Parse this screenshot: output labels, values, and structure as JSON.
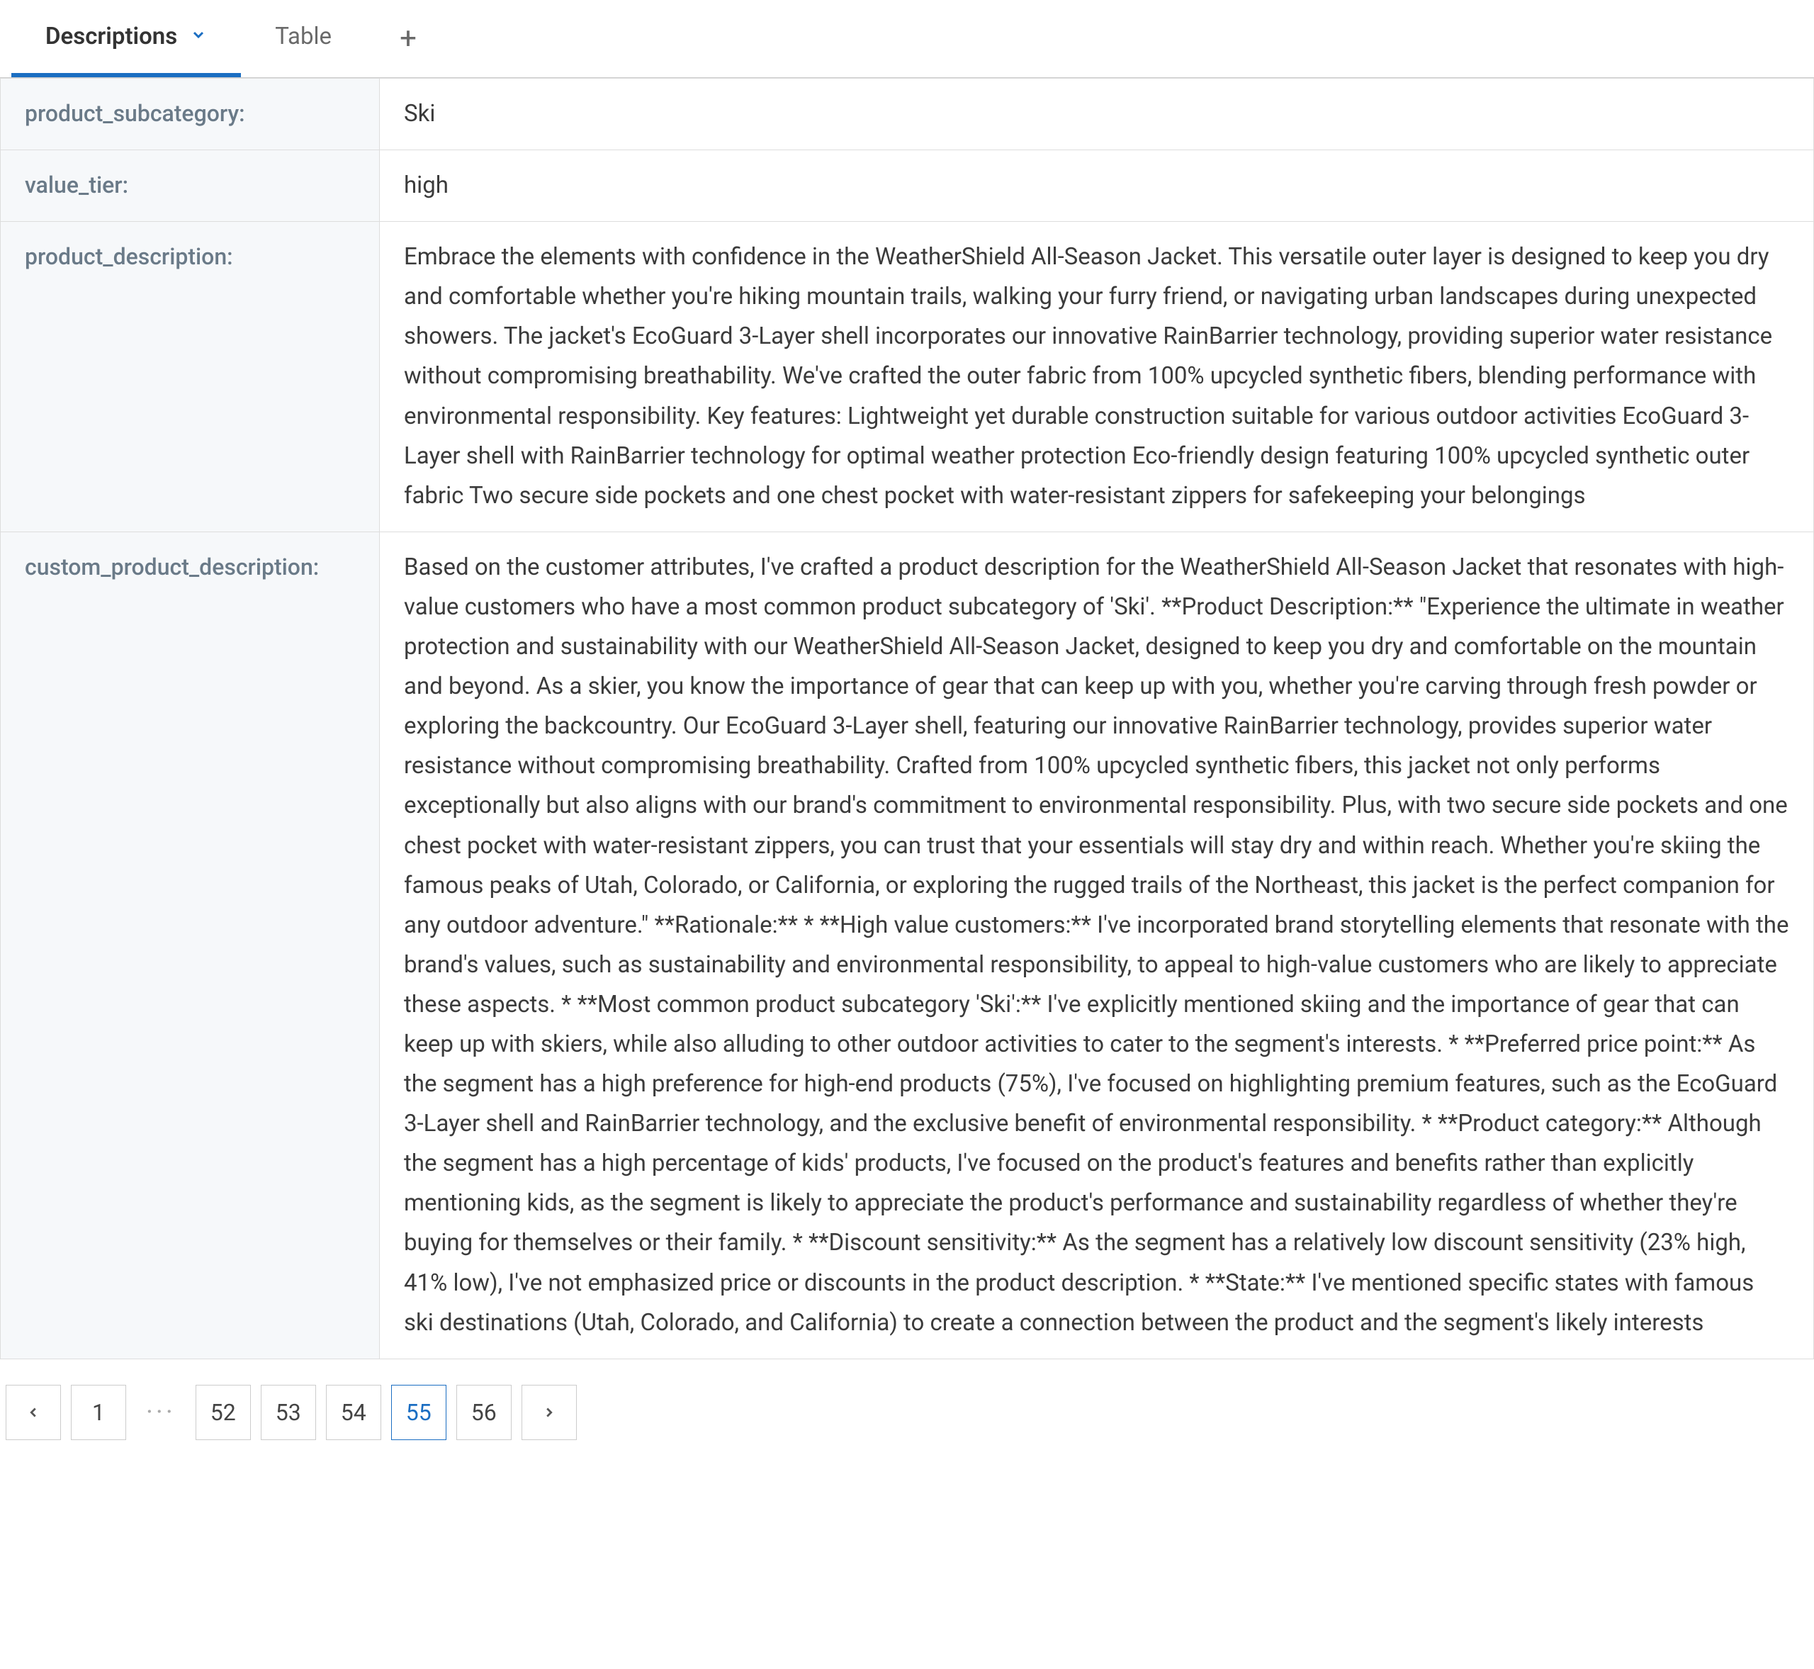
{
  "tabs": {
    "items": [
      {
        "label": "Descriptions",
        "active": true,
        "has_menu": true
      },
      {
        "label": "Table",
        "active": false,
        "has_menu": false
      }
    ],
    "add_label": "+"
  },
  "rows": [
    {
      "key": "product_subcategory:",
      "value": "Ski"
    },
    {
      "key": "value_tier:",
      "value": "high"
    },
    {
      "key": "product_description:",
      "value": "Embrace the elements with confidence in the WeatherShield All-Season Jacket. This versatile outer layer is designed to keep you dry and comfortable whether you're hiking mountain trails, walking your furry friend, or navigating urban landscapes during unexpected showers. The jacket's EcoGuard 3-Layer shell incorporates our innovative RainBarrier technology, providing superior water resistance without compromising breathability. We've crafted the outer fabric from 100% upcycled synthetic fibers, blending performance with environmental responsibility. Key features: Lightweight yet durable construction suitable for various outdoor activities EcoGuard 3-Layer shell with RainBarrier technology for optimal weather protection Eco-friendly design featuring 100% upcycled synthetic outer fabric Two secure side pockets and one chest pocket with water-resistant zippers for safekeeping your belongings"
    },
    {
      "key": "custom_product_description:",
      "value": "Based on the customer attributes, I've crafted a product description for the WeatherShield All-Season Jacket that resonates with high-value customers who have a most common product subcategory of 'Ski'. **Product Description:** \"Experience the ultimate in weather protection and sustainability with our WeatherShield All-Season Jacket, designed to keep you dry and comfortable on the mountain and beyond. As a skier, you know the importance of gear that can keep up with you, whether you're carving through fresh powder or exploring the backcountry. Our EcoGuard 3-Layer shell, featuring our innovative RainBarrier technology, provides superior water resistance without compromising breathability. Crafted from 100% upcycled synthetic fibers, this jacket not only performs exceptionally but also aligns with our brand's commitment to environmental responsibility. Plus, with two secure side pockets and one chest pocket with water-resistant zippers, you can trust that your essentials will stay dry and within reach. Whether you're skiing the famous peaks of Utah, Colorado, or California, or exploring the rugged trails of the Northeast, this jacket is the perfect companion for any outdoor adventure.\" **Rationale:** * **High value customers:** I've incorporated brand storytelling elements that resonate with the brand's values, such as sustainability and environmental responsibility, to appeal to high-value customers who are likely to appreciate these aspects. * **Most common product subcategory 'Ski':** I've explicitly mentioned skiing and the importance of gear that can keep up with skiers, while also alluding to other outdoor activities to cater to the segment's interests. * **Preferred price point:** As the segment has a high preference for high-end products (75%), I've focused on highlighting premium features, such as the EcoGuard 3-Layer shell and RainBarrier technology, and the exclusive benefit of environmental responsibility. * **Product category:** Although the segment has a high percentage of kids' products, I've focused on the product's features and benefits rather than explicitly mentioning kids, as the segment is likely to appreciate the product's performance and sustainability regardless of whether they're buying for themselves or their family. * **Discount sensitivity:** As the segment has a relatively low discount sensitivity (23% high, 41% low), I've not emphasized price or discounts in the product description. * **State:** I've mentioned specific states with famous ski destinations (Utah, Colorado, and California) to create a connection between the product and the segment's likely interests"
    }
  ],
  "pagination": {
    "prev": "<",
    "next": ">",
    "ellipsis": "···",
    "pages": [
      "1",
      "52",
      "53",
      "54",
      "55",
      "56"
    ],
    "current": "55"
  }
}
